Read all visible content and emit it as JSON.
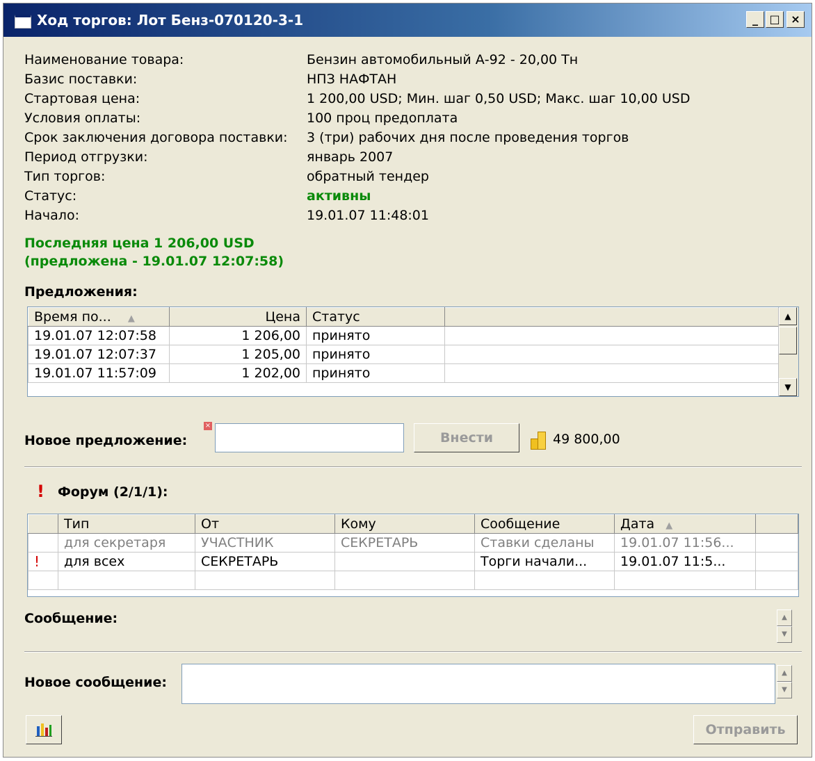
{
  "window": {
    "title": "Ход торгов: Лот Бенз-070120-3-1",
    "controls": [
      "_",
      "□",
      "×"
    ]
  },
  "info": [
    {
      "label": "Наименование товара:",
      "value": "Бензин автомобильный А-92 - 20,00 Тн"
    },
    {
      "label": "Базис поставки:",
      "value": "НПЗ НАФТАН"
    },
    {
      "label": "Стартовая цена:",
      "value": "1 200,00 USD; Мин. шаг 0,50 USD; Макс. шаг 10,00 USD"
    },
    {
      "label": "Условия оплаты:",
      "value": "100 проц предоплата"
    },
    {
      "label": "Срок заключения договора поставки:",
      "value": "3 (три) рабочих дня после проведения торгов"
    },
    {
      "label": "Период отгрузки:",
      "value": "январь 2007"
    },
    {
      "label": "Тип торгов:",
      "value": "обратный тендер"
    },
    {
      "label": "Статус:",
      "value": "активны"
    },
    {
      "label": "Начало:",
      "value": "19.01.07 11:48:01"
    }
  ],
  "last_price": {
    "line1": "Последняя цена 1 206,00 USD",
    "line2": "(предложена - 19.01.07 12:07:58)"
  },
  "offers": {
    "heading": "Предложения:",
    "columns": [
      "Время по...",
      "Цена",
      "Статус",
      ""
    ],
    "rows": [
      [
        "19.01.07 12:07:58",
        "1 206,00",
        "принято"
      ],
      [
        "19.01.07 12:07:37",
        "1 205,00",
        "принято"
      ],
      [
        "19.01.07 11:57:09",
        "1 202,00",
        "принято"
      ]
    ]
  },
  "new_offer": {
    "label": "Новое предложение:",
    "value": "",
    "submit": "Внести",
    "balance": "49 800,00"
  },
  "forum": {
    "heading": "Форум (2/1/1):",
    "columns": [
      "",
      "Тип",
      "От",
      "Кому",
      "Сообщение",
      "Дата",
      ""
    ],
    "rows": [
      [
        "",
        "для секретаря",
        "УЧАСТНИК",
        "СЕКРЕТАРЬ",
        "Ставки сделаны",
        "19.01.07 11:56..."
      ],
      [
        "!",
        "для всех",
        "СЕКРЕТАРЬ",
        "",
        "Торги начали...",
        "19.01.07 11:5..."
      ]
    ]
  },
  "message": {
    "label": "Сообщение:"
  },
  "new_message": {
    "label": "Новое сообщение:",
    "value": "",
    "send": "Отправить"
  }
}
